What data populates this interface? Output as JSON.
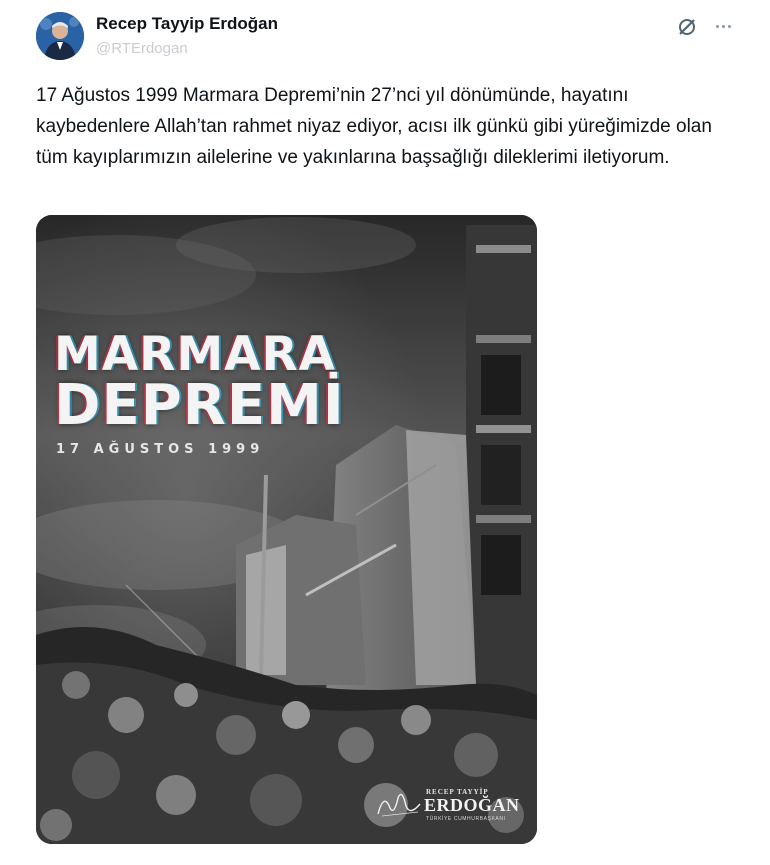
{
  "author": {
    "display_name": "Recep Tayyip Erdoğan",
    "handle": "@RTErdogan"
  },
  "tweet": {
    "text": "17 Ağustos 1999 Marmara Depremi’nin 27’nci yıl dönümünde, hayatını kaybedenlere Allah’tan rahmet niyaz ediyor, acısı ilk günkü gibi yüreğimizde olan tüm kayıplarımızın ailelerine ve yakınlarına başsağlığı dileklerimi iletiyorum."
  },
  "media": {
    "title_line1": "MARMARA",
    "title_line2": "DEPREMİ",
    "date": "17 AĞUSTOS 1999",
    "signature": {
      "subtitle": "RECEP TAYYİP",
      "name": "ERDOĞAN",
      "role": "TÜRKİYE CUMHURBAŞKANI"
    }
  },
  "icons": {
    "grok": "grok-icon",
    "more": "more-icon"
  }
}
